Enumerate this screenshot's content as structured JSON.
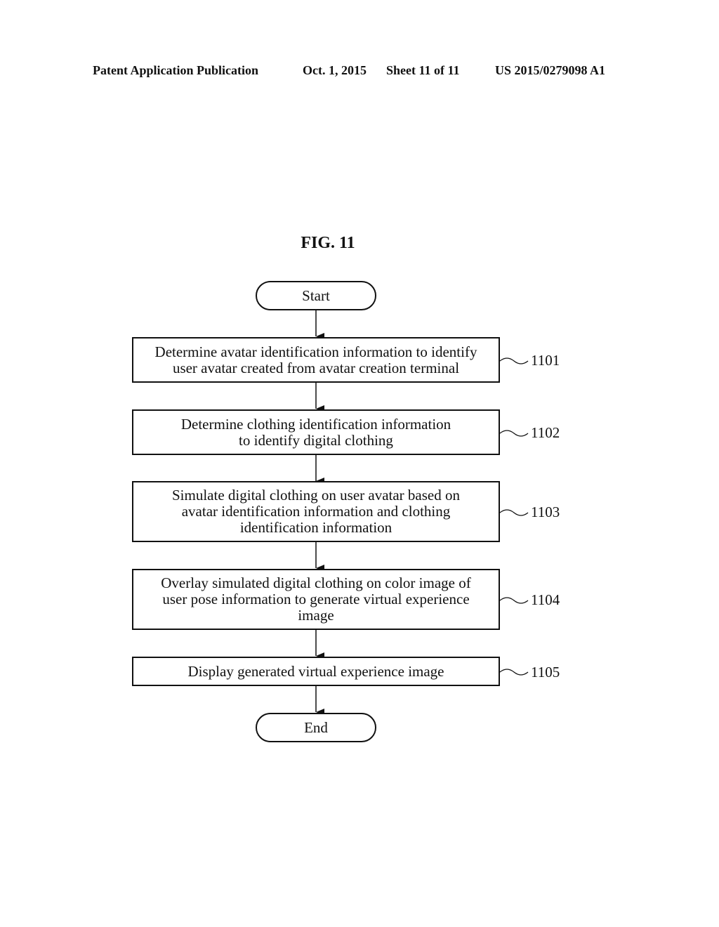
{
  "header": {
    "publication": "Patent Application Publication",
    "date": "Oct. 1, 2015",
    "sheet": "Sheet 11 of 11",
    "number": "US 2015/0279098 A1"
  },
  "figure": {
    "title": "FIG. 11",
    "start_label": "Start",
    "end_label": "End",
    "steps": [
      {
        "ref": "1101",
        "text": "Determine avatar identification information to identify user avatar created from avatar creation terminal"
      },
      {
        "ref": "1102",
        "text": "Determine clothing identification information to identify digital clothing"
      },
      {
        "ref": "1103",
        "text": "Simulate digital clothing on user avatar based on avatar identification information and clothing identification information"
      },
      {
        "ref": "1104",
        "text": "Overlay simulated digital clothing on color image of user pose information to generate virtual experience image"
      },
      {
        "ref": "1105",
        "text": "Display generated virtual experience image"
      }
    ]
  }
}
